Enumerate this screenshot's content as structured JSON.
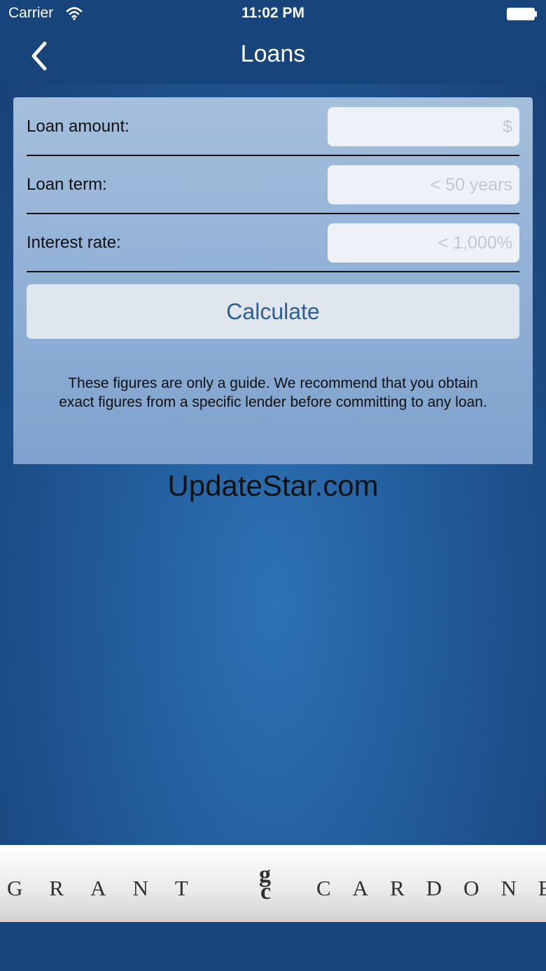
{
  "status_bar": {
    "carrier": "Carrier",
    "time": "11:02 PM"
  },
  "nav": {
    "title": "Loans",
    "back_icon": "chevron-left-icon"
  },
  "form": {
    "rows": [
      {
        "label": "Loan amount:",
        "placeholder": "$",
        "value": ""
      },
      {
        "label": "Loan term:",
        "placeholder": "< 50 years",
        "value": ""
      },
      {
        "label": "Interest rate:",
        "placeholder": "< 1,000%",
        "value": ""
      }
    ],
    "calculate_label": "Calculate",
    "disclaimer": "These figures are only a guide. We recommend that you obtain exact figures from a specific lender before committing to any loan."
  },
  "watermark": "UpdateStar.com",
  "footer": {
    "left": "GRANT",
    "right": "CARDONE",
    "monogram_g": "g",
    "monogram_c": "c"
  },
  "colors": {
    "nav_background": "#18447c",
    "accent": "#2b5f95"
  }
}
